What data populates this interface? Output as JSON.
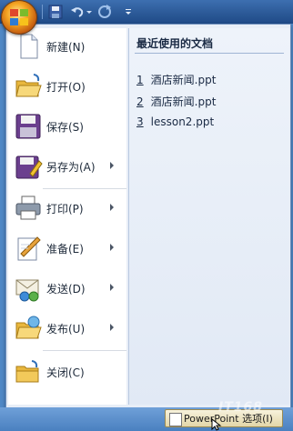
{
  "menu": {
    "items": [
      {
        "label": "新建(N)",
        "icon": "new-doc-icon",
        "submenu": false
      },
      {
        "label": "打开(O)",
        "icon": "open-folder-icon",
        "submenu": false
      },
      {
        "label": "保存(S)",
        "icon": "save-disk-icon",
        "submenu": false
      },
      {
        "label": "另存为(A)",
        "icon": "save-as-icon",
        "submenu": true
      },
      {
        "label": "打印(P)",
        "icon": "printer-icon",
        "submenu": true
      },
      {
        "label": "准备(E)",
        "icon": "prepare-icon",
        "submenu": true
      },
      {
        "label": "发送(D)",
        "icon": "send-icon",
        "submenu": true
      },
      {
        "label": "发布(U)",
        "icon": "publish-icon",
        "submenu": true
      },
      {
        "label": "关闭(C)",
        "icon": "close-folder-icon",
        "submenu": false
      }
    ]
  },
  "recent": {
    "title": "最近使用的文档",
    "files": [
      {
        "num": "1",
        "name": "酒店新闻.ppt"
      },
      {
        "num": "2",
        "name": "酒店新闻.ppt"
      },
      {
        "num": "3",
        "name": "lesson2.ppt"
      }
    ]
  },
  "footer": {
    "options_label": "PowerPoint 选项(I)",
    "watermark": "IT168"
  },
  "colors": {
    "accent": "#f5a623",
    "menu_bg": "#e8eef7",
    "bar": "#4a80c0"
  }
}
